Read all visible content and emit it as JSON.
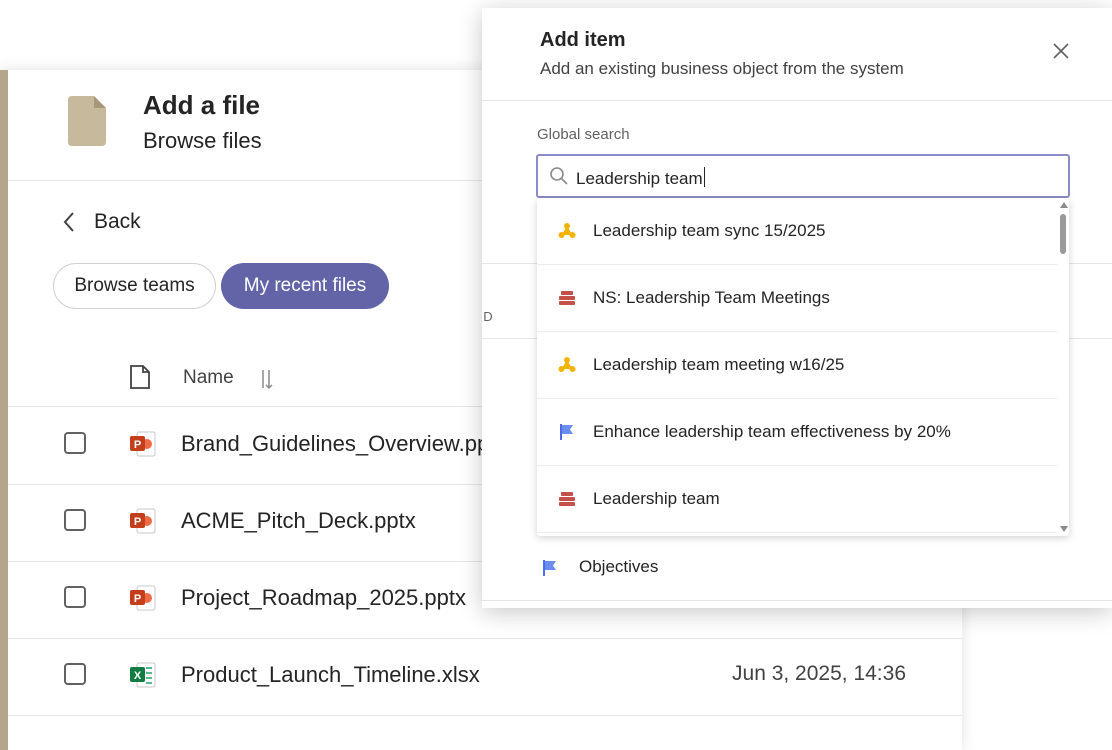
{
  "file_panel": {
    "title": "Add a file",
    "subtitle": "Browse files",
    "back_label": "Back",
    "pills": {
      "browse_teams": "Browse teams",
      "my_recent_files": "My recent files"
    },
    "column_name": "Name",
    "files": [
      {
        "name": "Brand_Guidelines_Overview.pptx",
        "type": "pptx",
        "date": ""
      },
      {
        "name": "ACME_Pitch_Deck.pptx",
        "type": "pptx",
        "date": ""
      },
      {
        "name": "Project_Roadmap_2025.pptx",
        "type": "pptx",
        "date": ""
      },
      {
        "name": "Product_Launch_Timeline.xlsx",
        "type": "xlsx",
        "date": "Jun 3, 2025, 14:36"
      }
    ],
    "accent_color": "#b4a68a",
    "selected_pill_color": "#6264a7"
  },
  "dialog": {
    "title": "Add item",
    "subtitle": "Add an existing business object from the system",
    "search_label": "Global search",
    "search_value": "Leadership team",
    "results": [
      {
        "label": "Leadership team sync 15/2025",
        "icon": "meeting-icon"
      },
      {
        "label": "NS: Leadership Team Meetings",
        "icon": "series-icon"
      },
      {
        "label": "Leadership team meeting w16/25",
        "icon": "meeting-icon"
      },
      {
        "label": "Enhance leadership team effectiveness by 20%",
        "icon": "flag-icon"
      },
      {
        "label": "Leadership team",
        "icon": "series-icon"
      }
    ],
    "below_item": {
      "label": "Objectives",
      "icon": "flag-icon"
    },
    "partial_text": ": D"
  }
}
